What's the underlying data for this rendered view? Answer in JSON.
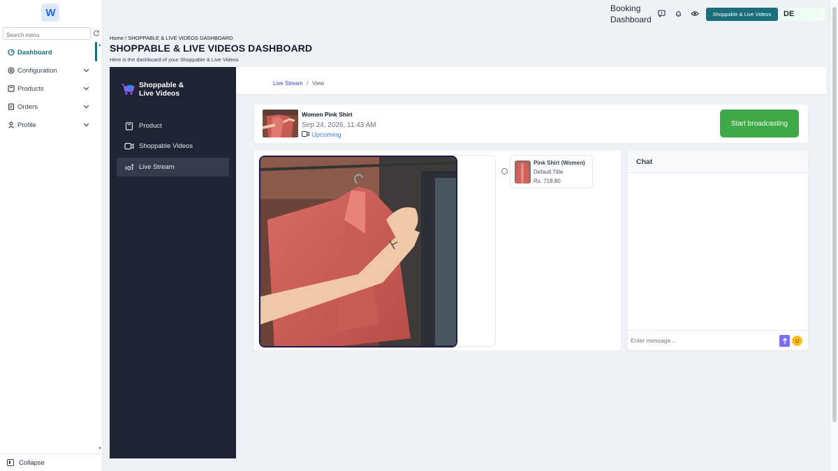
{
  "sidebar": {
    "search_placeholder": "Search menu",
    "items": [
      {
        "label": "Dashboard",
        "icon": "dashboard-icon",
        "active": true
      },
      {
        "label": "Configuration",
        "icon": "settings-icon"
      },
      {
        "label": "Products",
        "icon": "products-icon"
      },
      {
        "label": "Orders",
        "icon": "orders-icon"
      },
      {
        "label": "Profile",
        "icon": "user-icon"
      }
    ],
    "collapse_label": "Collapse"
  },
  "topbar": {
    "title_line1": "Booking",
    "title_line2": "Dashboard",
    "badge": "Shoppable & Live Videos",
    "user_initials": "DE"
  },
  "page": {
    "breadcrumb": "Home / SHOPPABLE & LIVE VIDEOS DASHBOARD",
    "title": "SHOPPABLE & LIVE VIDEOS DASHBOARD",
    "subtitle": "Here is the dashboard of your Shoppable & Live Videos"
  },
  "plugin": {
    "brand_line1": "Shoppable &",
    "brand_line2": "Live Videos",
    "nav": [
      {
        "label": "Product",
        "icon": "product-icon"
      },
      {
        "label": "Shoppable Videos",
        "icon": "video-icon"
      },
      {
        "label": "Live Stream",
        "icon": "live-stream-icon",
        "active": true
      }
    ]
  },
  "content": {
    "crumb_link": "Live Stream",
    "crumb_sep": "/",
    "crumb_current": "View"
  },
  "stream": {
    "name": "Women Pink Shirt",
    "date": "Sep 24, 2026, 11:43 AM",
    "status": "Upcoming",
    "broadcast_label": "Start broadcasting"
  },
  "product": {
    "name": "Pink Shirt (Women)",
    "variant": "Default Title",
    "price": "Rs. 718.80"
  },
  "chat": {
    "title": "Chat",
    "placeholder": "Enter message..."
  },
  "colors": {
    "accent": "#14707a",
    "dark_sidebar": "#1e2433",
    "broadcast_green": "#3fa947",
    "status_blue": "#3b82f6"
  }
}
